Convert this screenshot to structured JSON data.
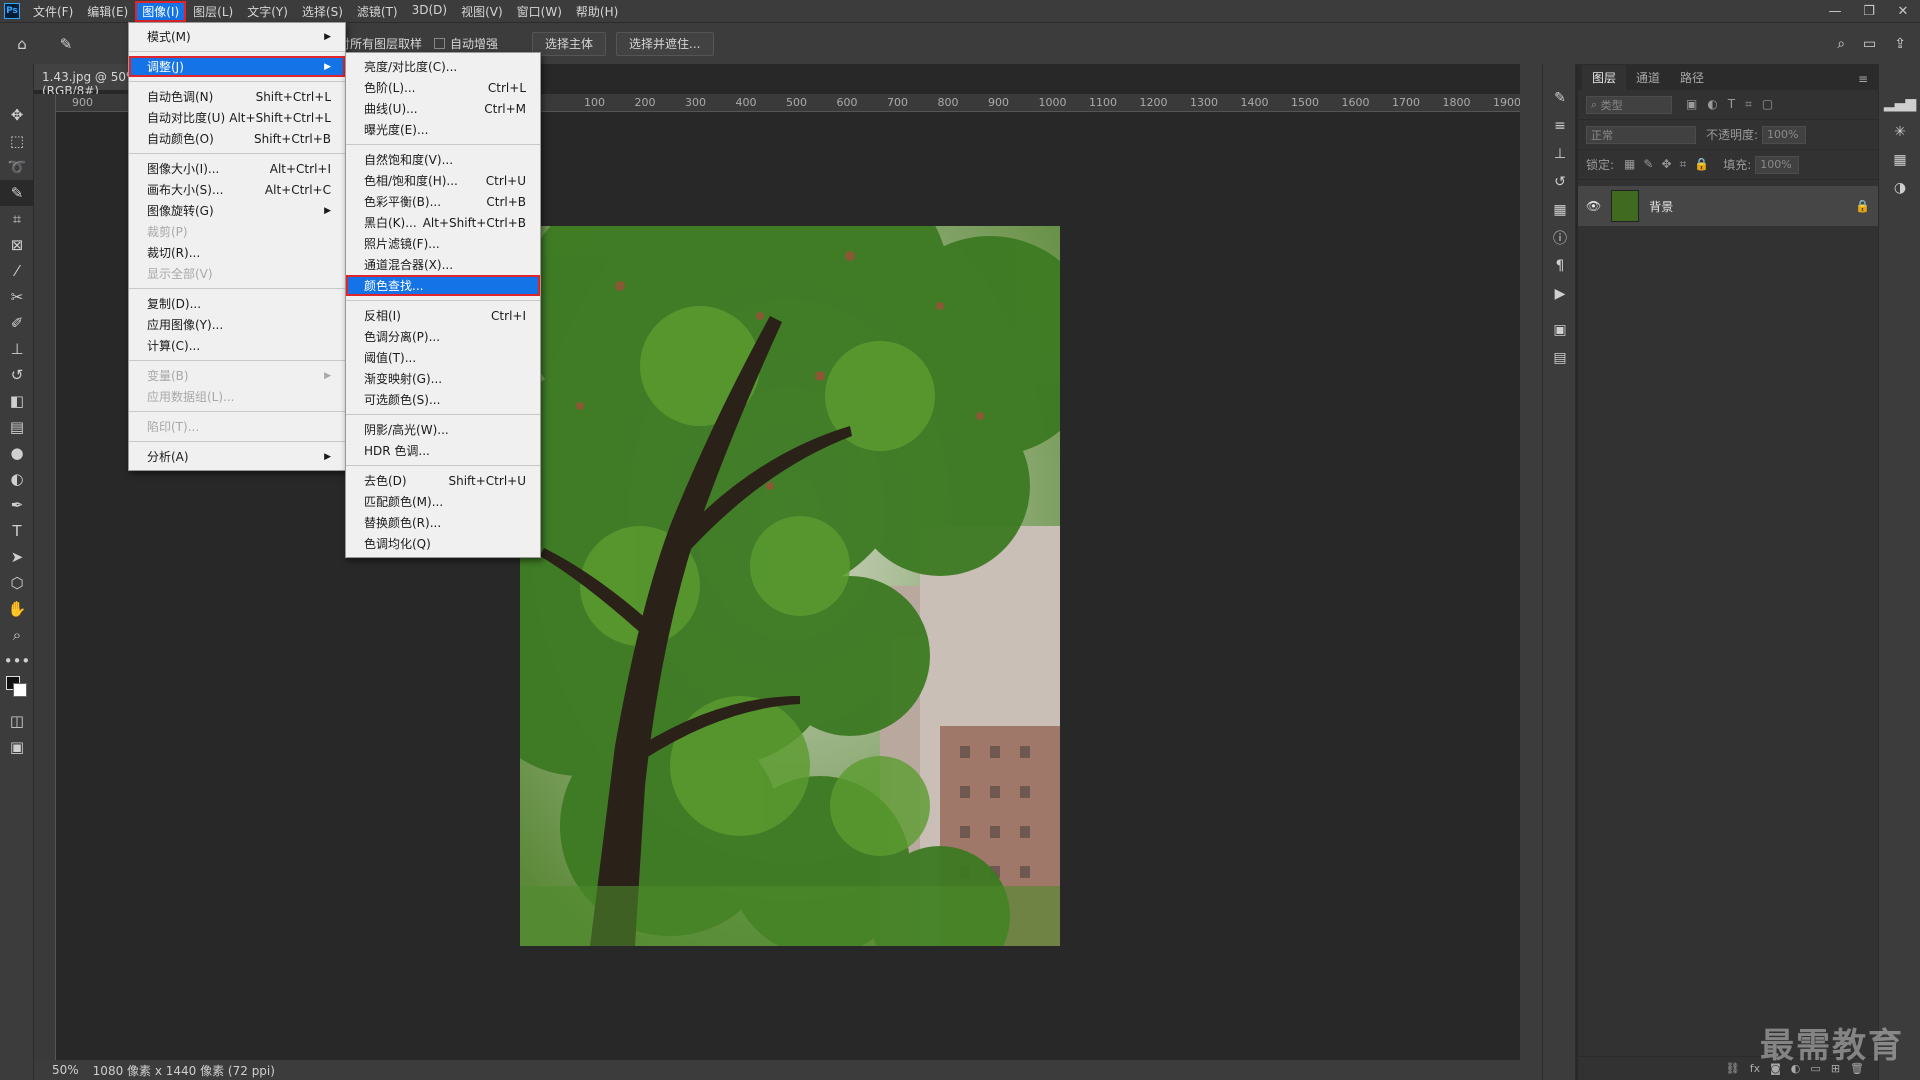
{
  "menubar": {
    "logo": "Ps",
    "items": [
      "文件(F)",
      "编辑(E)",
      "图像(I)",
      "图层(L)",
      "文字(Y)",
      "选择(S)",
      "滤镜(T)",
      "3D(D)",
      "视图(V)",
      "窗口(W)",
      "帮助(H)"
    ],
    "window_controls": [
      "—",
      "❐",
      "✕"
    ]
  },
  "options": {
    "sample_all_layers": "对所有图层取样",
    "auto_enhance": "自动增强",
    "select_subject": "选择主体",
    "select_and_mask": "选择并遮住..."
  },
  "document": {
    "tab_title": "1.43.jpg @ 50% (RGB/8#)",
    "ruler_ticks": [
      "900",
      "100",
      "200",
      "300",
      "400",
      "500",
      "600",
      "700",
      "800",
      "900",
      "1000",
      "1100",
      "1200",
      "1300",
      "1400",
      "1500",
      "1600",
      "1700",
      "1800",
      "1900"
    ],
    "status_zoom": "50%",
    "status_info": "1080 像素 x 1440 像素 (72 ppi)"
  },
  "image_menu": [
    {
      "label": "模式(M)",
      "shortcut": "",
      "submenu": true
    },
    {
      "sep": true
    },
    {
      "label": "调整(J)",
      "shortcut": "",
      "submenu": true,
      "state": "hl-red"
    },
    {
      "sep": true
    },
    {
      "label": "自动色调(N)",
      "shortcut": "Shift+Ctrl+L"
    },
    {
      "label": "自动对比度(U)",
      "shortcut": "Alt+Shift+Ctrl+L"
    },
    {
      "label": "自动颜色(O)",
      "shortcut": "Shift+Ctrl+B"
    },
    {
      "sep": true
    },
    {
      "label": "图像大小(I)...",
      "shortcut": "Alt+Ctrl+I"
    },
    {
      "label": "画布大小(S)...",
      "shortcut": "Alt+Ctrl+C"
    },
    {
      "label": "图像旋转(G)",
      "shortcut": "",
      "submenu": true
    },
    {
      "label": "裁剪(P)",
      "shortcut": "",
      "state": "disabled"
    },
    {
      "label": "裁切(R)...",
      "shortcut": ""
    },
    {
      "label": "显示全部(V)",
      "shortcut": "",
      "state": "disabled"
    },
    {
      "sep": true
    },
    {
      "label": "复制(D)...",
      "shortcut": ""
    },
    {
      "label": "应用图像(Y)...",
      "shortcut": ""
    },
    {
      "label": "计算(C)...",
      "shortcut": ""
    },
    {
      "sep": true
    },
    {
      "label": "变量(B)",
      "shortcut": "",
      "submenu": true,
      "state": "disabled"
    },
    {
      "label": "应用数据组(L)...",
      "shortcut": "",
      "state": "disabled"
    },
    {
      "sep": true
    },
    {
      "label": "陷印(T)...",
      "shortcut": "",
      "state": "disabled"
    },
    {
      "sep": true
    },
    {
      "label": "分析(A)",
      "shortcut": "",
      "submenu": true
    }
  ],
  "adjust_menu": [
    {
      "label": "亮度/对比度(C)...",
      "shortcut": ""
    },
    {
      "label": "色阶(L)...",
      "shortcut": "Ctrl+L"
    },
    {
      "label": "曲线(U)...",
      "shortcut": "Ctrl+M"
    },
    {
      "label": "曝光度(E)...",
      "shortcut": ""
    },
    {
      "sep": true
    },
    {
      "label": "自然饱和度(V)...",
      "shortcut": ""
    },
    {
      "label": "色相/饱和度(H)...",
      "shortcut": "Ctrl+U"
    },
    {
      "label": "色彩平衡(B)...",
      "shortcut": "Ctrl+B"
    },
    {
      "label": "黑白(K)...",
      "shortcut": "Alt+Shift+Ctrl+B"
    },
    {
      "label": "照片滤镜(F)...",
      "shortcut": ""
    },
    {
      "label": "通道混合器(X)...",
      "shortcut": ""
    },
    {
      "label": "颜色查找...",
      "shortcut": "",
      "state": "hl-red"
    },
    {
      "sep": true
    },
    {
      "label": "反相(I)",
      "shortcut": "Ctrl+I"
    },
    {
      "label": "色调分离(P)...",
      "shortcut": ""
    },
    {
      "label": "阈值(T)...",
      "shortcut": ""
    },
    {
      "label": "渐变映射(G)...",
      "shortcut": ""
    },
    {
      "label": "可选颜色(S)...",
      "shortcut": ""
    },
    {
      "sep": true
    },
    {
      "label": "阴影/高光(W)...",
      "shortcut": ""
    },
    {
      "label": "HDR 色调...",
      "shortcut": ""
    },
    {
      "sep": true
    },
    {
      "label": "去色(D)",
      "shortcut": "Shift+Ctrl+U"
    },
    {
      "label": "匹配颜色(M)...",
      "shortcut": ""
    },
    {
      "label": "替换颜色(R)...",
      "shortcut": ""
    },
    {
      "label": "色调均化(Q)",
      "shortcut": ""
    }
  ],
  "layers": {
    "tabs": [
      "图层",
      "通道",
      "路径"
    ],
    "filter_placeholder": "类型",
    "blend_mode": "正常",
    "opacity_label": "不透明度:",
    "opacity_value": "100%",
    "lock_label": "锁定:",
    "fill_label": "填充:",
    "fill_value": "100%",
    "layer_name": "背景"
  },
  "watermark": "最需教育",
  "colors": {
    "accent": "#1473e6",
    "highlight_border": "#e0242c"
  }
}
